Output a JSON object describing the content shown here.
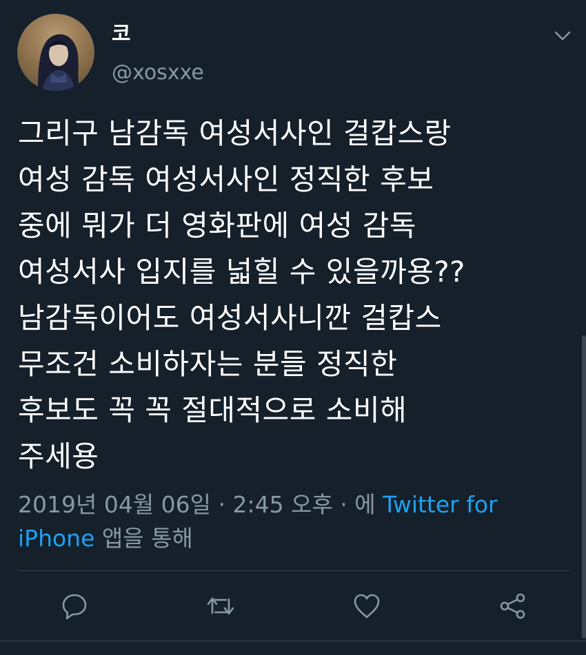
{
  "tweet": {
    "display_name": "코",
    "handle": "@xosxxe",
    "text": "그리구 남감독 여성서사인 걸캅스랑\n여성 감독 여성서사인 정직한 후보\n중에 뭐가 더 영화판에 여성 감독\n여성서사 입지를 넓힐 수 있을까용??\n남감독이어도 여성서사니깐 걸캅스\n무조건 소비하자는 분들 정직한\n후보도 꼭 꼭 절대적으로 소비해\n주세용",
    "timestamp": "2019년 04월 06일 · 2:45 오후 · 에 ",
    "source_link": "Twitter for iPhone",
    "source_suffix": " 앱을 통해"
  },
  "icons": {
    "avatar": "profile-avatar",
    "menu": "chevron-down-icon",
    "reply": "reply-icon",
    "retweet": "retweet-icon",
    "like": "heart-icon",
    "share": "share-icon"
  },
  "colors": {
    "background": "#15202b",
    "primary_text": "#ffffff",
    "secondary_text": "#8899a6",
    "link": "#1da1f2",
    "divider": "#38444d"
  }
}
